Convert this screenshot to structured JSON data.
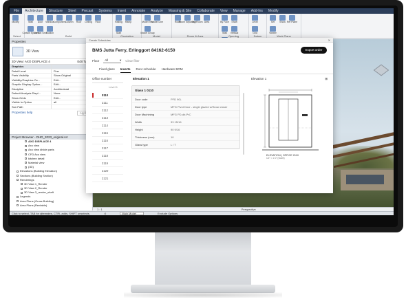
{
  "menubar": {
    "tabs": [
      {
        "label": "File",
        "active": false
      },
      {
        "label": "Architecture",
        "active": true
      },
      {
        "label": "Structure",
        "active": false
      },
      {
        "label": "Steel",
        "active": false
      },
      {
        "label": "Precast",
        "active": false
      },
      {
        "label": "Systems",
        "active": false
      },
      {
        "label": "Insert",
        "active": false
      },
      {
        "label": "Annotate",
        "active": false
      },
      {
        "label": "Analyze",
        "active": false
      },
      {
        "label": "Massing & Site",
        "active": false
      },
      {
        "label": "Collaborate",
        "active": false
      },
      {
        "label": "View",
        "active": false
      },
      {
        "label": "Manage",
        "active": false
      },
      {
        "label": "Add-Ins",
        "active": false
      },
      {
        "label": "Modify",
        "active": false
      }
    ]
  },
  "ribbon": {
    "groups": [
      {
        "label": "Select",
        "tools": [
          "Modify"
        ]
      },
      {
        "label": "Build",
        "tools": [
          "Wall",
          "Door",
          "Window",
          "Component",
          "Column",
          "Roof",
          "Ceiling",
          "Floor",
          "Curtain System",
          "Curtain Grid",
          "Mullion"
        ]
      },
      {
        "label": "Circulation",
        "tools": [
          "Railing",
          "Ramp",
          "Stair"
        ]
      },
      {
        "label": "Model",
        "tools": [
          "Model Text",
          "Model Line",
          "Model Group"
        ]
      },
      {
        "label": "Room & Area",
        "tools": [
          "Room",
          "Room Separator",
          "Tag Room",
          "Area"
        ]
      },
      {
        "label": "Opening",
        "tools": [
          "By Face",
          "Shaft",
          "Wall",
          "Vertical",
          "Dormer"
        ]
      },
      {
        "label": "Datum",
        "tools": [
          "Level",
          "Grid"
        ]
      },
      {
        "label": "Work Plane",
        "tools": [
          "Set",
          "Show",
          "Ref Plane",
          "Viewer"
        ]
      }
    ]
  },
  "properties": {
    "title": "Properties",
    "type_name": "3D View",
    "view_dropdown": "3D View: AXO DISPLACE 4",
    "edit_type": "Edit Type",
    "rows": [
      {
        "k": "Graphics",
        "v": "",
        "section": true
      },
      {
        "k": "Detail Level",
        "v": "Fine"
      },
      {
        "k": "Parts Visibility",
        "v": "Show Original"
      },
      {
        "k": "Visibility/Graphics Ov...",
        "v": "Edit..."
      },
      {
        "k": "Graphic Display Option...",
        "v": "Edit..."
      },
      {
        "k": "Discipline",
        "v": "Architectural"
      },
      {
        "k": "Default Analysis Displ...",
        "v": "None"
      },
      {
        "k": "Show Grids",
        "v": "Edit..."
      },
      {
        "k": "Visible In Option",
        "v": "all"
      },
      {
        "k": "Sun Path",
        "v": ""
      }
    ],
    "help_link": "Properties help",
    "apply": "Apply"
  },
  "browser": {
    "title": "Project Browser - DHD_2023_original.rvt",
    "items": [
      {
        "label": "AXO DISPLACE 4",
        "indent": 3,
        "bold": true
      },
      {
        "label": "Axo view",
        "indent": 3
      },
      {
        "label": "Axo view divide parts",
        "indent": 3
      },
      {
        "label": "CFD Axo view",
        "indent": 3
      },
      {
        "label": "kitchen detail",
        "indent": 3
      },
      {
        "label": "Material view",
        "indent": 3
      },
      {
        "label": "{3D}",
        "indent": 3
      },
      {
        "label": "Elevations (Building Elevation)",
        "indent": 1
      },
      {
        "label": "Sections (Building Section)",
        "indent": 1
      },
      {
        "label": "Renderings",
        "indent": 1
      },
      {
        "label": "3D View 1_Render",
        "indent": 2
      },
      {
        "label": "3D View 2_Render",
        "indent": 2
      },
      {
        "label": "3D View 3_render_shaft",
        "indent": 2
      },
      {
        "label": "Legends",
        "indent": 1
      },
      {
        "label": "Area Plans (Gross Building)",
        "indent": 1
      },
      {
        "label": "Area Plans (Rentable)",
        "indent": 1
      }
    ]
  },
  "viewbar": {
    "scale": "1 : 1",
    "view_mode": "Perspective"
  },
  "statusbar": {
    "hint": "Click to select, TAB for alternates, CTRL adds, SHIFT unselects.",
    "zoom": ":0",
    "model": "Main Model",
    "exclude": "Exclude Options"
  },
  "dialog": {
    "window_title": "Create Schedules",
    "title": "BMS Jutta Ferry, Erlinggort 84162-6150",
    "export_button": "Export order",
    "floor_label": "Floor",
    "floor_value": "All",
    "clear_filter": "Clear filter",
    "tabs": [
      {
        "label": "Fixed glass",
        "active": false
      },
      {
        "label": "Inserts",
        "active": true
      },
      {
        "label": "Door schedule",
        "active": false
      },
      {
        "label": "Hardware BOM",
        "active": false
      }
    ],
    "left_header": "Office number",
    "left_top": "Level 1",
    "list": [
      "0110",
      "2111",
      "2112",
      "2113",
      "2114",
      "2115",
      "2116",
      "2117",
      "2118",
      "2119",
      "2120",
      "2121"
    ],
    "selected_index": 0,
    "elevation_header": "Elevation 1",
    "card_title": "Glass 1 0110",
    "card_rows": [
      {
        "k": "Door code",
        "v": "PFD 90L"
      },
      {
        "k": "Door type",
        "v": "MFG Pivot Door - single glazed w/Snow closer"
      },
      {
        "k": "Door Machining",
        "v": "MFG PD-db-PrC"
      },
      {
        "k": "Width",
        "v": "33 15/16"
      },
      {
        "k": "Height",
        "v": "90 9/16"
      },
      {
        "k": "Thickness (mm)",
        "v": "10"
      },
      {
        "k": "Glass type",
        "v": "L / T"
      }
    ],
    "right_header": "Elevation 1",
    "caption_title": "ELEVATION | OFFICE 2110",
    "caption_sub": "1/2\" = 1'-0\" (Scale)"
  }
}
